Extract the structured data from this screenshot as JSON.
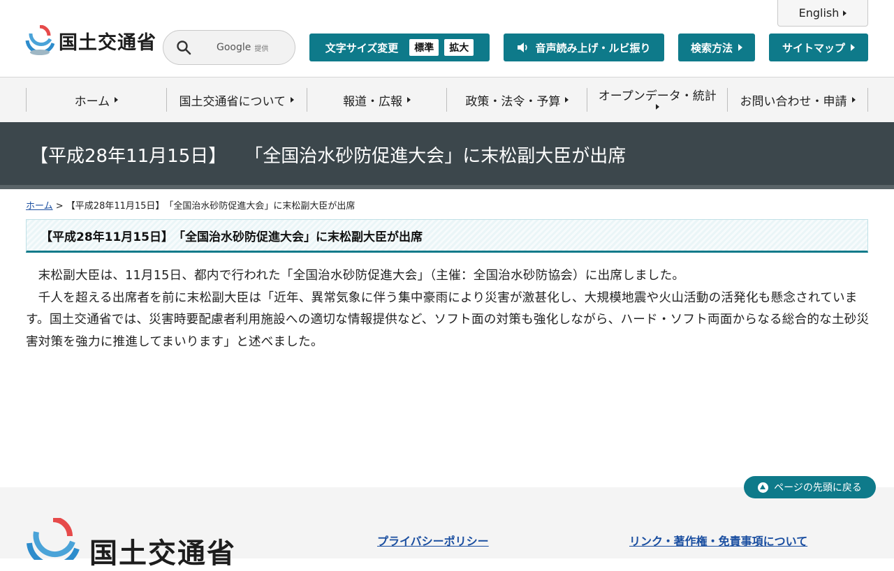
{
  "header": {
    "logo_text": "国土交通省",
    "search": {
      "provider": "Google",
      "provider_suffix": "提供"
    },
    "english_label": "English",
    "font_size": {
      "label": "文字サイズ変更",
      "standard": "標準",
      "large": "拡大"
    },
    "speech_label": "音声読み上げ・ルビ振り",
    "search_method_label": "検索方法",
    "sitemap_label": "サイトマップ"
  },
  "nav": {
    "items": [
      "ホーム",
      "国土交通省について",
      "報道・広報",
      "政策・法令・予算",
      "オープンデータ・統計",
      "お問い合わせ・申請"
    ]
  },
  "page": {
    "title": "【平成28年11月15日】　　「全国治水砂防促進大会」に末松副大臣が出席",
    "breadcrumb": {
      "home": "ホーム",
      "separator": " > ",
      "current": "【平成28年11月15日】　「全国治水砂防促進大会」に末松副大臣が出席"
    },
    "heading": "【平成28年11月15日】　「全国治水砂防促進大会」に末松副大臣が出席",
    "paragraphs": [
      "末松副大臣は、11月15日、都内で行われた「全国治水砂防促進大会」（主催：全国治水砂防協会）に出席しました。",
      "千人を超える出席者を前に末松副大臣は「近年、異常気象に伴う集中豪雨により災害が激甚化し、大規模地震や火山活動の活発化も懸念されています。国土交通省では、災害時要配慮者利用施設への適切な情報提供など、ソフト面の対策も強化しながら、ハード・ソフト両面からなる総合的な土砂災害対策を強力に推進してまいります」と述べました。"
    ]
  },
  "footer": {
    "back_to_top": "ページの先頭に戻る",
    "logo_text": "国土交通省",
    "links": [
      "プライバシーポリシー",
      "リンク・著作権・免責事項について"
    ]
  },
  "colors": {
    "accent": "#0e7a8a",
    "band": "#3c474c",
    "link": "#1a4ea0"
  }
}
